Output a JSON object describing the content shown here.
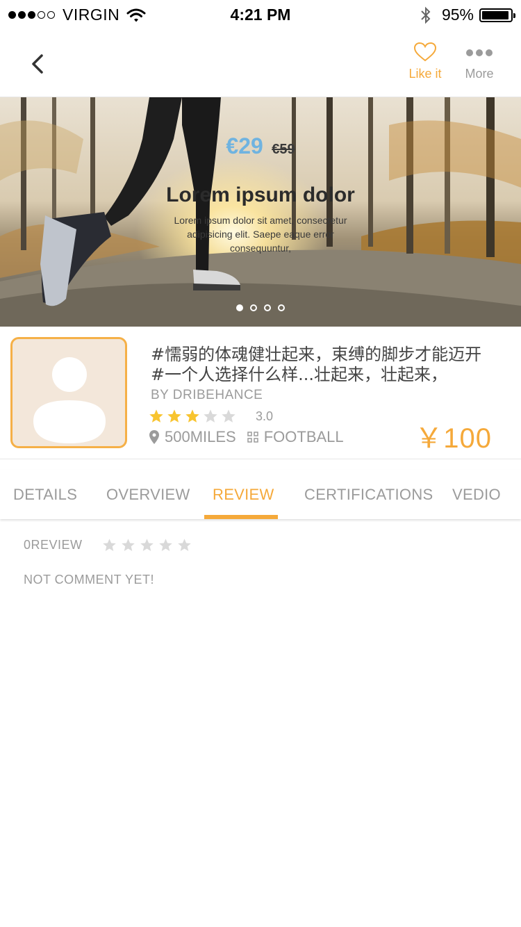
{
  "status_bar": {
    "carrier": "VIRGIN",
    "time": "4:21 PM",
    "battery": "95%",
    "battery_level": 0.95,
    "signal_bars": 3,
    "signal_total": 5
  },
  "nav": {
    "like_label": "Like it",
    "more_label": "More"
  },
  "hero": {
    "price_new": "€29",
    "price_old": "€59",
    "title": "Lorem ipsum dolor",
    "description": "Lorem ipsum dolor sit amet, consectetur adipisicing elit. Saepe eaque error consequuntur,",
    "page_count": 4,
    "active_page": 0
  },
  "product": {
    "title_line1": "#懦弱的体魂健壮起来，束缚的脚步才能迈开",
    "title_line2": "#一个人选择什么样...壮起来，壮起来，",
    "author": "BY DRIBEHANCE",
    "rating": 3.0,
    "rating_text": "3.0",
    "distance": "500MILES",
    "category": "FOOTBALL",
    "price": "￥100"
  },
  "tabs": [
    {
      "label": "DETAILS"
    },
    {
      "label": "OVERVIEW"
    },
    {
      "label": "REVIEW"
    },
    {
      "label": "CERTIFICATIONS"
    },
    {
      "label": "VEDIO"
    }
  ],
  "active_tab": "REVIEW",
  "review": {
    "label": "0REVIEW",
    "stars": 0,
    "empty_text": "NOT COMMENT YET!"
  },
  "colors": {
    "accent": "#f5a93a",
    "star_filled": "#f8c42f",
    "star_empty": "#d9d9d9",
    "price_blue": "#6fb3e0",
    "muted": "#9b9b9b"
  }
}
